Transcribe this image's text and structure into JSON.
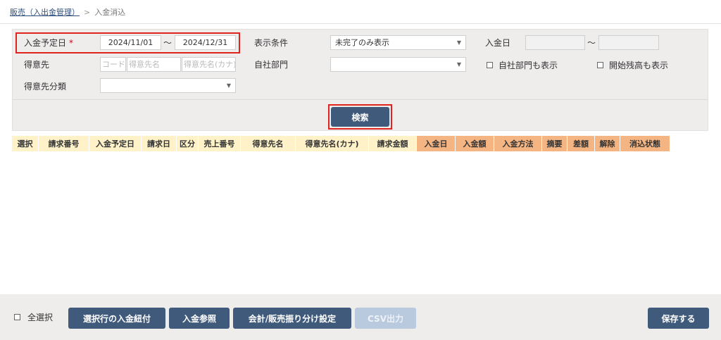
{
  "breadcrumb": {
    "parent": "販売（入出金管理）",
    "separator": ">",
    "current": "入金消込"
  },
  "search": {
    "scheduled_date_label": "入金予定日",
    "required_mark": "*",
    "date_from": "2024/11/01",
    "range_sep": "〜",
    "date_to": "2024/12/31",
    "customer_label": "得意先",
    "customer_code_placeholder": "コード",
    "customer_name_placeholder": "得意先名",
    "customer_kana_placeholder": "得意先名(カナ)",
    "customer_category_label": "得意先分類",
    "customer_category_value": "",
    "display_condition_label": "表示条件",
    "display_condition_value": "未完了のみ表示",
    "own_dept_label": "自社部門",
    "own_dept_value": "",
    "payment_date_label": "入金日",
    "payment_date_from": "",
    "payment_date_to": "",
    "show_own_dept_label": "自社部門も表示",
    "show_opening_balance_label": "開始残高も表示",
    "search_button": "検索"
  },
  "grid": {
    "columns": [
      {
        "label": "選択",
        "group": "billing"
      },
      {
        "label": "請求番号",
        "group": "billing"
      },
      {
        "label": "入金予定日",
        "group": "billing"
      },
      {
        "label": "請求日",
        "group": "billing"
      },
      {
        "label": "区分",
        "group": "billing"
      },
      {
        "label": "売上番号",
        "group": "billing"
      },
      {
        "label": "得意先名",
        "group": "billing"
      },
      {
        "label": "得意先名(カナ)",
        "group": "billing"
      },
      {
        "label": "請求金額",
        "group": "billing"
      },
      {
        "label": "入金日",
        "group": "payment"
      },
      {
        "label": "入金額",
        "group": "payment"
      },
      {
        "label": "入金方法",
        "group": "payment"
      },
      {
        "label": "摘要",
        "group": "payment"
      },
      {
        "label": "差額",
        "group": "payment"
      },
      {
        "label": "解除",
        "group": "payment"
      },
      {
        "label": "消込状態",
        "group": "payment"
      }
    ],
    "rows": []
  },
  "footer": {
    "select_all_label": "全選択",
    "link_button": "選択行の入金紐付",
    "payment_ref_button": "入金参照",
    "allocation_button": "会計/販売振り分け設定",
    "csv_button": "CSV出力",
    "save_button": "保存する"
  },
  "colors": {
    "primary_button": "#3f5a7b",
    "disabled_button": "#b9c9de",
    "highlight": "#e0231c",
    "billing_header": "#fff2c8",
    "payment_header": "#f5b583",
    "panel": "#efecec"
  }
}
